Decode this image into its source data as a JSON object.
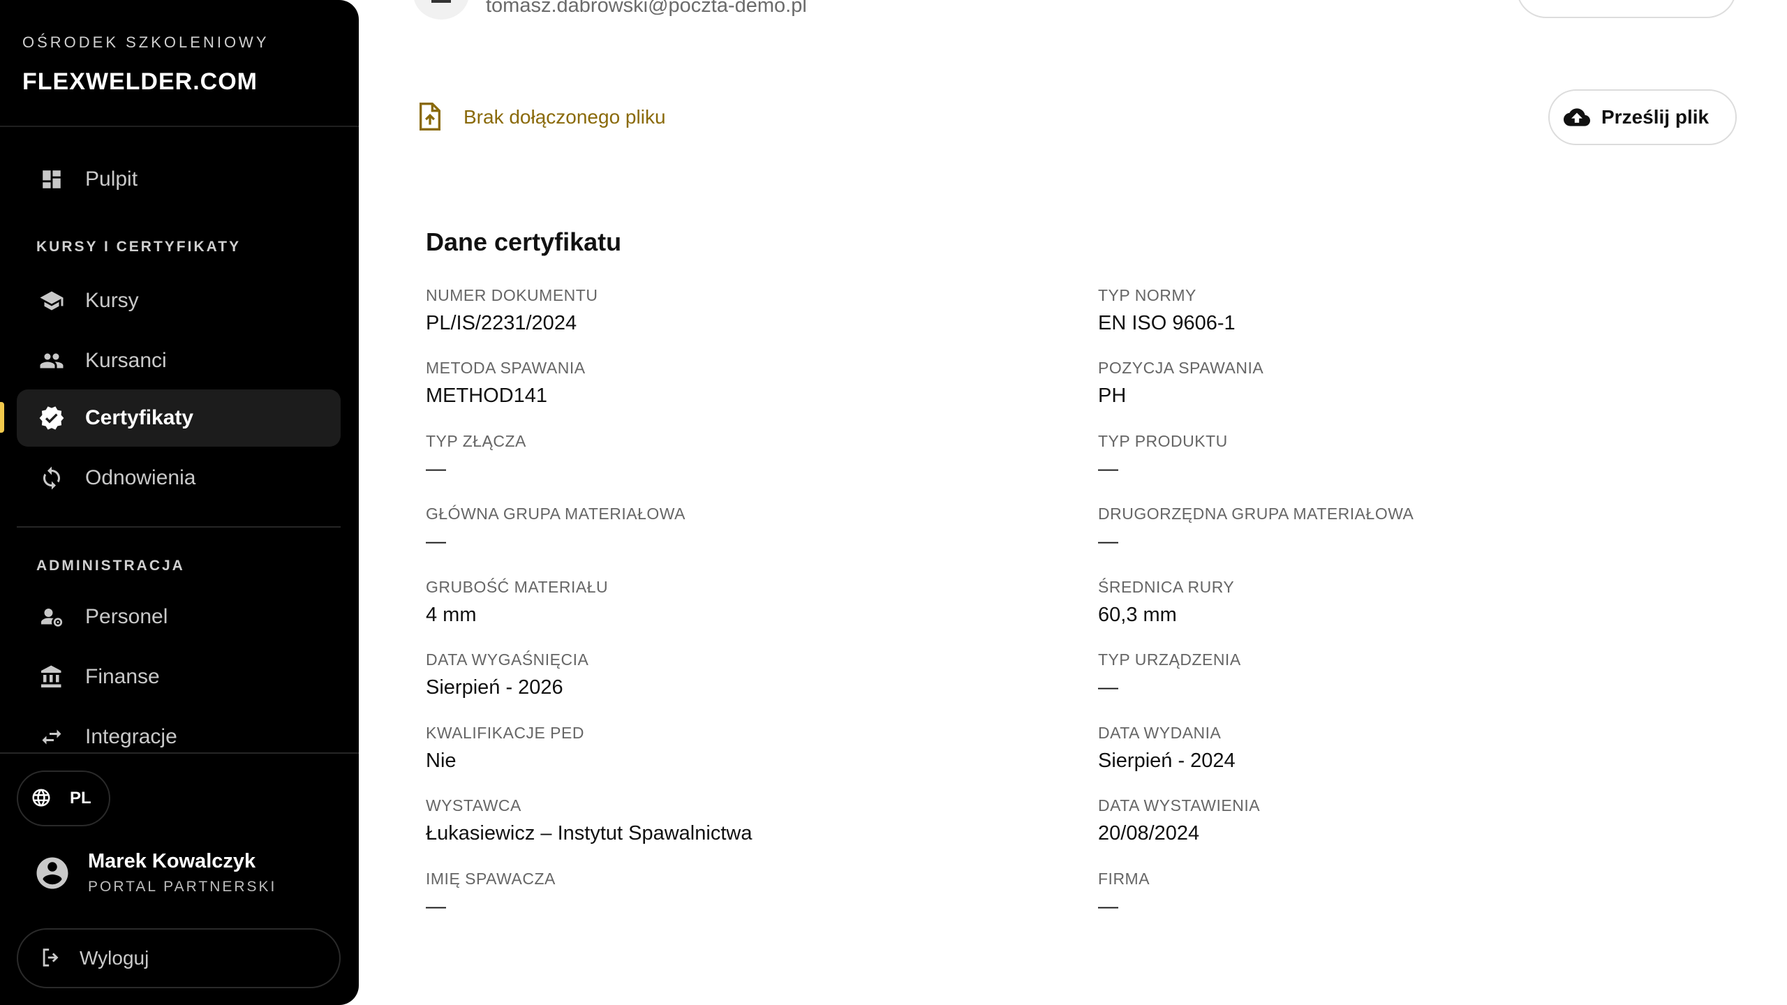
{
  "sidebar": {
    "brand_sub": "OŚRODEK SZKOLENIOWY",
    "brand_name": "FLEXWELDER.COM",
    "dashboard": "Pulpit",
    "section_courses": "KURSY I CERTYFIKATY",
    "items": [
      {
        "label": "Kursy",
        "icon": "graduation-cap-icon"
      },
      {
        "label": "Kursanci",
        "icon": "people-icon"
      },
      {
        "label": "Certyfikaty",
        "icon": "verified-badge-icon",
        "active": true
      },
      {
        "label": "Odnowienia",
        "icon": "refresh-icon"
      }
    ],
    "section_admin": "ADMINISTRACJA",
    "admin_items": [
      {
        "label": "Personel",
        "icon": "staff-settings-icon"
      },
      {
        "label": "Finanse",
        "icon": "bank-icon"
      },
      {
        "label": "Integracje",
        "icon": "swap-arrows-icon"
      }
    ],
    "language": "PL",
    "user_name": "Marek Kowalczyk",
    "user_role": "PORTAL PARTNERSKI",
    "logout": "Wyloguj",
    "accent_color": "#f2c94c"
  },
  "header": {
    "email": "tomasz.dabrowski@poczta-demo.pl"
  },
  "file": {
    "status": "Brak dołączonego pliku",
    "upload_label": "Prześlij plik",
    "status_color": "#8a6a0a"
  },
  "certificate": {
    "title": "Dane certyfikatu",
    "fields": [
      {
        "label": "NUMER DOKUMENTU",
        "value": "PL/IS/2231/2024"
      },
      {
        "label": "TYP NORMY",
        "value": "EN ISO 9606-1"
      },
      {
        "label": "METODA SPAWANIA",
        "value": "METHOD141"
      },
      {
        "label": "POZYCJA SPAWANIA",
        "value": "PH"
      },
      {
        "label": "TYP ZŁĄCZA",
        "value": "—"
      },
      {
        "label": "TYP PRODUKTU",
        "value": "—"
      },
      {
        "label": "GŁÓWNA GRUPA MATERIAŁOWA",
        "value": "—"
      },
      {
        "label": "DRUGORZĘDNA GRUPA MATERIAŁOWA",
        "value": "—"
      },
      {
        "label": "GRUBOŚĆ MATERIAŁU",
        "value": "4 mm"
      },
      {
        "label": "ŚREDNICA RURY",
        "value": "60,3 mm"
      },
      {
        "label": "DATA WYGAŚNIĘCIA",
        "value": "Sierpień - 2026"
      },
      {
        "label": "TYP URZĄDZENIA",
        "value": "—"
      },
      {
        "label": "KWALIFIKACJE PED",
        "value": "Nie"
      },
      {
        "label": "DATA WYDANIA",
        "value": "Sierpień - 2024"
      },
      {
        "label": "WYSTAWCA",
        "value": "Łukasiewicz – Instytut Spawalnictwa"
      },
      {
        "label": "DATA WYSTAWIENIA",
        "value": "20/08/2024"
      },
      {
        "label": "IMIĘ SPAWACZA",
        "value": "—"
      },
      {
        "label": "FIRMA",
        "value": "—"
      }
    ]
  }
}
